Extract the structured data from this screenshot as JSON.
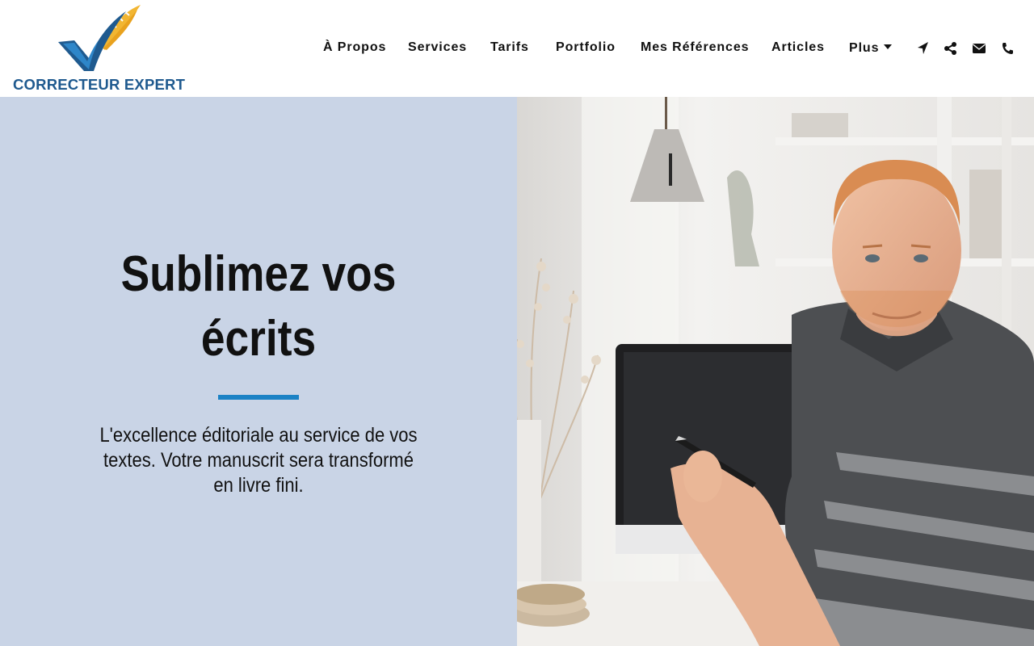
{
  "brand": {
    "name": "CORRECTEUR EXPERT",
    "colors": {
      "blue": "#1f5a8f",
      "accent_blue": "#1b82c5",
      "gold": "#f2b632"
    }
  },
  "nav": {
    "items": [
      {
        "label": "À Propos"
      },
      {
        "label": "Services"
      },
      {
        "label": "Tarifs"
      },
      {
        "label": "Portfolio"
      },
      {
        "label": "Mes Références"
      },
      {
        "label": "Articles"
      },
      {
        "label": "Plus"
      }
    ],
    "icons": [
      "location-arrow-icon",
      "share-icon",
      "envelope-icon",
      "phone-icon"
    ]
  },
  "hero": {
    "title": "Sublimez vos écrits",
    "subtitle": "L'excellence éditoriale au service de vos textes. Votre manuscrit sera transformé en livre fini.",
    "background": "#c9d4e6",
    "photo": "man-at-desk-holding-pen"
  }
}
